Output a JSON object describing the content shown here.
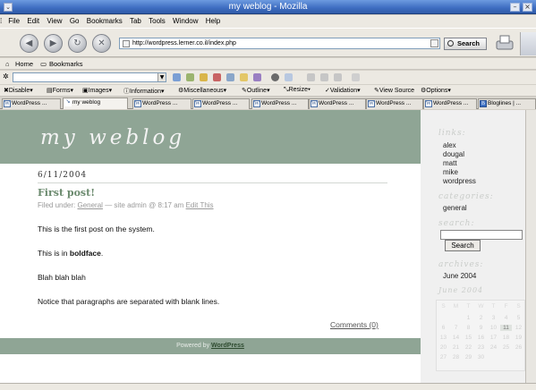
{
  "window": {
    "title": "my weblog - Mozilla"
  },
  "menubar": [
    "File",
    "Edit",
    "View",
    "Go",
    "Bookmarks",
    "Tab",
    "Tools",
    "Window",
    "Help"
  ],
  "navbar": {
    "url": "http://wordpress.lerner.co.il/index.php",
    "search_label": "Search"
  },
  "personal_toolbar": {
    "home": "Home",
    "bookmarks": "Bookmarks"
  },
  "devtoolbar": [
    "Disable",
    "Forms",
    "Images",
    "Information",
    "Miscellaneous",
    "Outline",
    "Resize",
    "Validation",
    "View Source",
    "Options"
  ],
  "tabs": [
    {
      "label": "WordPress ..."
    },
    {
      "label": "my weblog"
    },
    {
      "label": "WordPress ..."
    },
    {
      "label": "WordPress ..."
    },
    {
      "label": "WordPress ..."
    },
    {
      "label": "WordPress ..."
    },
    {
      "label": "WordPress ..."
    },
    {
      "label": "WordPress ..."
    },
    {
      "label": "Bloglines | ..."
    }
  ],
  "page": {
    "blog_title": "my weblog",
    "post": {
      "date": "6/11/2004",
      "title": "First post!",
      "meta_prefix": "Filed under:",
      "category": "General",
      "meta_mid": "— site admin @ 8:17 am",
      "edit_link": "Edit This",
      "paragraphs": [
        "This is the first post on the system.",
        "Blah blah blah",
        "Notice that paragraphs are separated with blank lines."
      ],
      "bold_para_prefix": "This is in ",
      "bold_para_word": "boldface",
      "bold_para_suffix": ".",
      "comments": "Comments (0)"
    },
    "footer_prefix": "Powered by",
    "footer_link": "WordPress"
  },
  "sidebar": {
    "links_heading": "links:",
    "links": [
      "alex",
      "dougal",
      "matt",
      "mike",
      "wordpress"
    ],
    "categories_heading": "categories:",
    "categories": [
      "general"
    ],
    "search_heading": "search:",
    "search_button": "Search",
    "archives_heading": "archives:",
    "archives": [
      "June 2004"
    ],
    "calendar": {
      "caption": "June 2004",
      "days": [
        "S",
        "M",
        "T",
        "W",
        "T",
        "F",
        "S"
      ],
      "weeks": [
        [
          "",
          "",
          "1",
          "2",
          "3",
          "4",
          "5"
        ],
        [
          "6",
          "7",
          "8",
          "9",
          "10",
          "11",
          "12"
        ],
        [
          "13",
          "14",
          "15",
          "16",
          "17",
          "18",
          "19"
        ],
        [
          "20",
          "21",
          "22",
          "23",
          "24",
          "25",
          "26"
        ],
        [
          "27",
          "28",
          "29",
          "30",
          "",
          "",
          ""
        ]
      ],
      "highlight": "11"
    }
  }
}
